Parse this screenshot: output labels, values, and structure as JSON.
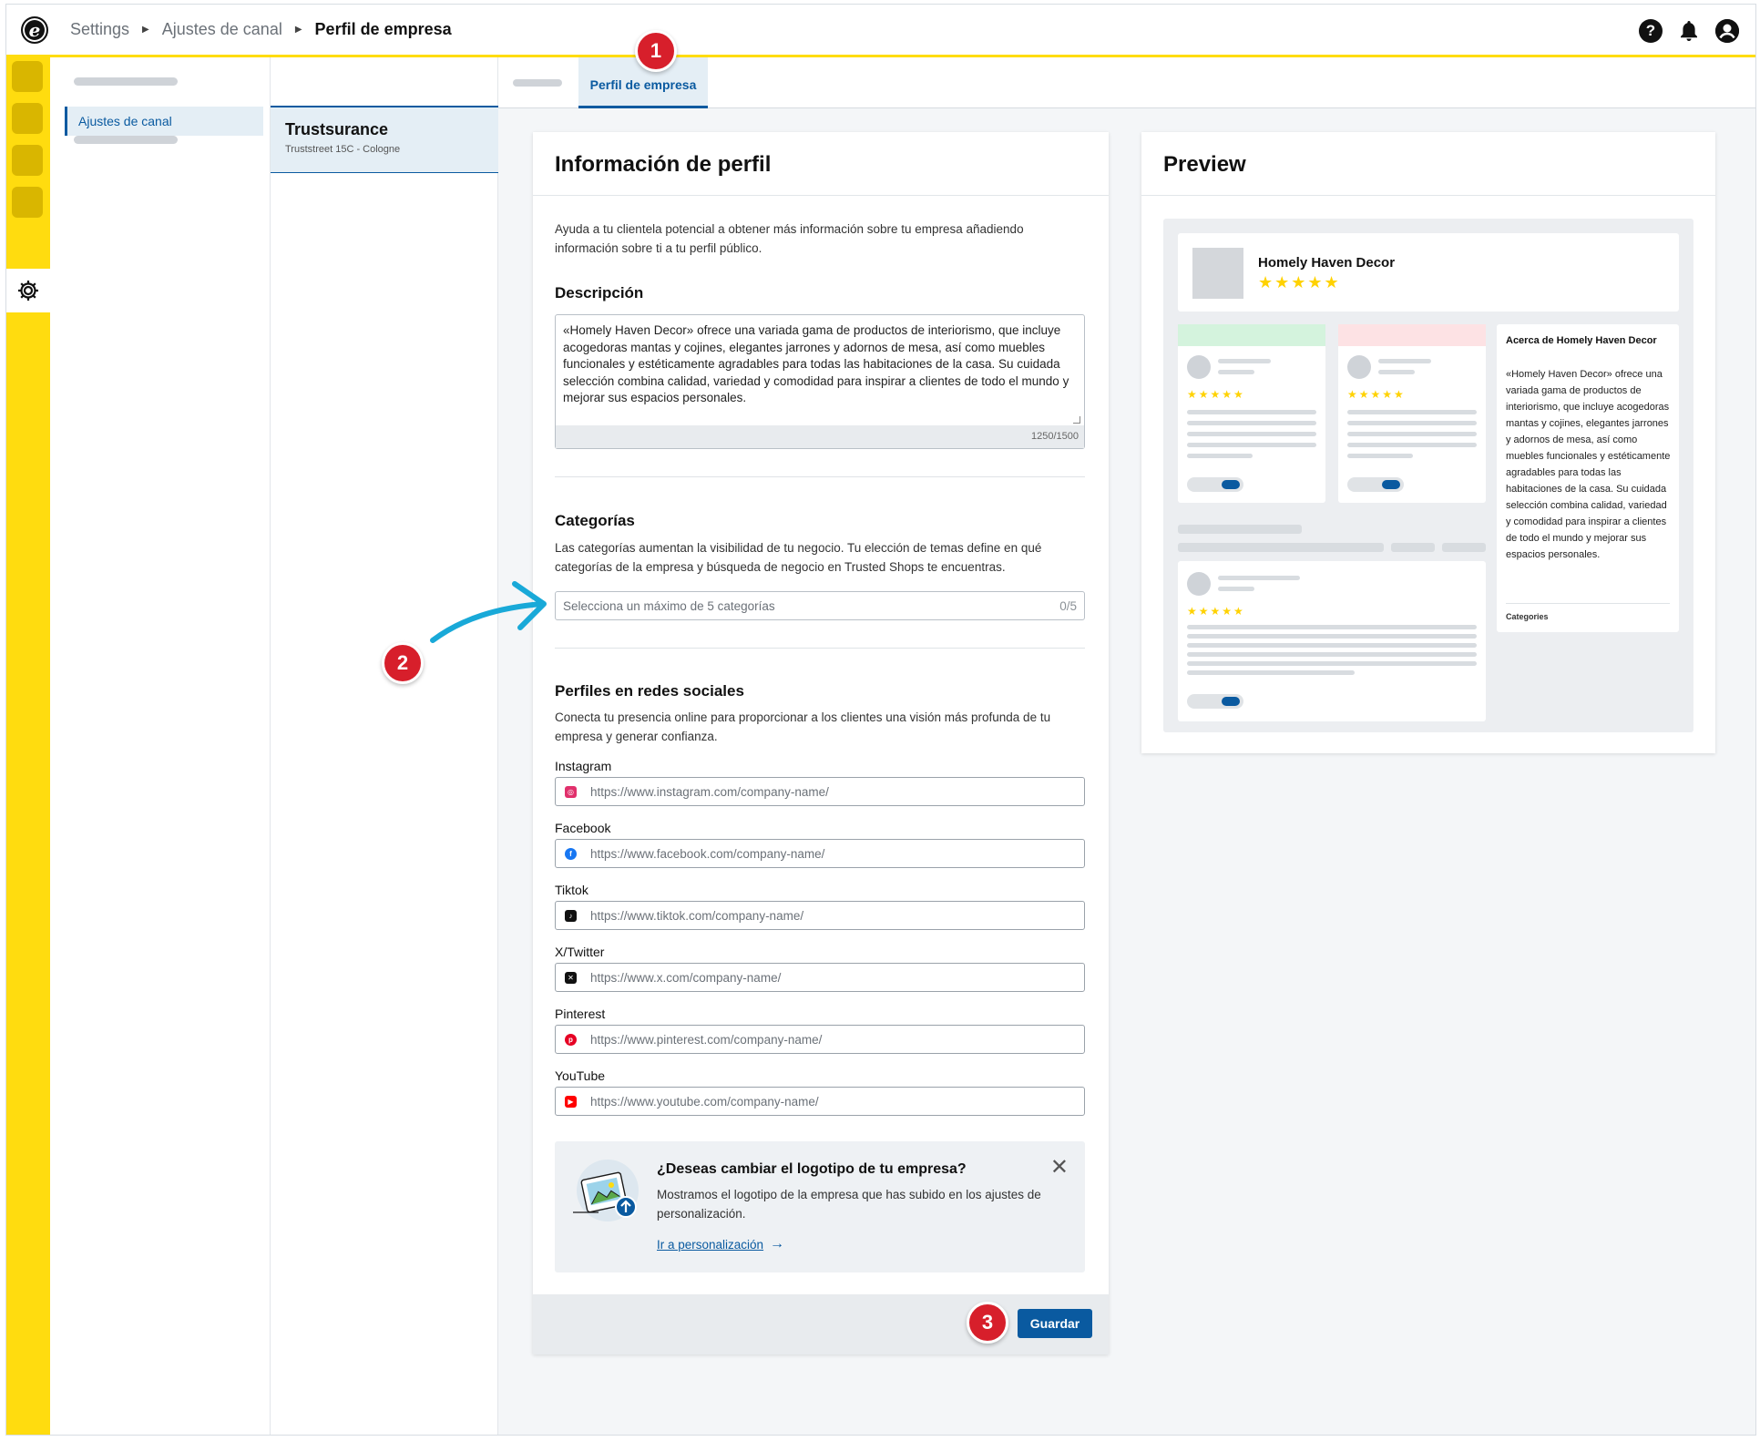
{
  "breadcrumb": {
    "root": "Settings",
    "parent": "Ajustes de canal",
    "current": "Perfil de empresa"
  },
  "topbar": {
    "logo_letter": "e",
    "help_icon": "question-circle-icon",
    "bell_icon": "bell-icon",
    "account_icon": "user-icon",
    "help_glyph": "?"
  },
  "nav": {
    "active_item": "Ajustes de canal"
  },
  "channel": {
    "name": "Trustsurance",
    "address": "Truststreet 15C - Cologne"
  },
  "tabs": {
    "active": "Perfil de empresa"
  },
  "form": {
    "title": "Información de perfil",
    "intro": "Ayuda a tu clientela potencial a obtener más información sobre tu empresa añadiendo información sobre ti a tu perfil público.",
    "description": {
      "title": "Descripción",
      "value": "«Homely Haven Decor» ofrece una variada gama de productos de interiorismo, que incluye acogedoras mantas y cojines, elegantes jarrones y adornos de mesa, así como muebles funcionales y estéticamente agradables para todas las habitaciones de la casa. Su cuidada selección combina calidad, variedad y comodidad para inspirar a clientes de todo el mundo y mejorar sus espacios personales.",
      "counter": "1250/1500"
    },
    "categories": {
      "title": "Categorías",
      "text": "Las categorías aumentan la visibilidad de tu negocio. Tu elección de temas define en qué categorías de la empresa y búsqueda de negocio en Trusted Shops te encuentras.",
      "placeholder": "Selecciona un máximo de 5 categorías",
      "count": "0/5"
    },
    "social": {
      "title": "Perfiles en redes sociales",
      "text": "Conecta tu presencia online para proporcionar a los clientes una visión más profunda de tu empresa y generar confianza.",
      "fields": [
        {
          "label": "Instagram",
          "placeholder": "https://www.instagram.com/company-name/",
          "icon": "instagram-icon",
          "color": "#e1306c"
        },
        {
          "label": "Facebook",
          "placeholder": "https://www.facebook.com/company-name/",
          "icon": "facebook-icon",
          "color": "#1877f2"
        },
        {
          "label": "Tiktok",
          "placeholder": "https://www.tiktok.com/company-name/",
          "icon": "tiktok-icon",
          "color": "#111111"
        },
        {
          "label": "X/Twitter",
          "placeholder": "https://www.x.com/company-name/",
          "icon": "x-icon",
          "color": "#111111"
        },
        {
          "label": "Pinterest",
          "placeholder": "https://www.pinterest.com/company-name/",
          "icon": "pinterest-icon",
          "color": "#e60023"
        },
        {
          "label": "YouTube",
          "placeholder": "https://www.youtube.com/company-name/",
          "icon": "youtube-icon",
          "color": "#ff0000"
        }
      ]
    },
    "logo_notice": {
      "title": "¿Deseas cambiar el logotipo de tu empresa?",
      "text": "Mostramos el logotipo de la empresa que has subido en los ajustes de personalización.",
      "link": "Ir a personalización"
    },
    "save_label": "Guardar"
  },
  "preview": {
    "title": "Preview",
    "company": "Homely Haven Decor",
    "stars": "★★★★★",
    "about_title": "Acerca de Homely Haven Decor",
    "about_text": "«Homely Haven Decor» ofrece una variada gama de productos de interiorismo, que incluye acogedoras mantas y cojines, elegantes jarrones y adornos de mesa, así como muebles funcionales y estéticamente agradables para todas las habitaciones de la casa. Su cuidada selección combina calidad, variedad y comodidad para inspirar a clientes de todo el mundo y mejorar sus espacios personales.",
    "categories_label": "Categories"
  },
  "annotations": [
    "1",
    "2",
    "3"
  ],
  "colors": {
    "brand_yellow": "#ffdc0f",
    "primary_blue": "#0a5aa0",
    "annotation_red": "#d71f2b",
    "arrow_cyan": "#19a9d8"
  }
}
